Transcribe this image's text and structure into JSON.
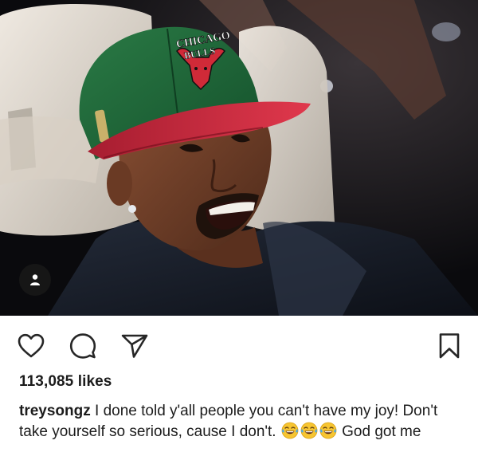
{
  "post": {
    "likes_text": "113,085 likes",
    "caption": {
      "username": "treysongz",
      "text_before_emoji": "I done told y'all people you can't have my joy! Don't take yourself so serious, cause I don't.",
      "emojis": [
        "face-with-tears-of-joy",
        "face-with-tears-of-joy",
        "face-with-tears-of-joy"
      ],
      "text_after_emoji": "God got me"
    },
    "cap_lettering": "CHICAGO BULLS"
  },
  "icons": {
    "like": "heart-outline-icon",
    "comment": "speech-bubble-icon",
    "share": "paper-plane-icon",
    "save": "bookmark-icon",
    "tag": "person-tag-icon"
  },
  "colors": {
    "cap_green": "#1f6b3a",
    "cap_brim_red": "#c8243a",
    "text": "#262626",
    "icon": "#262626"
  }
}
